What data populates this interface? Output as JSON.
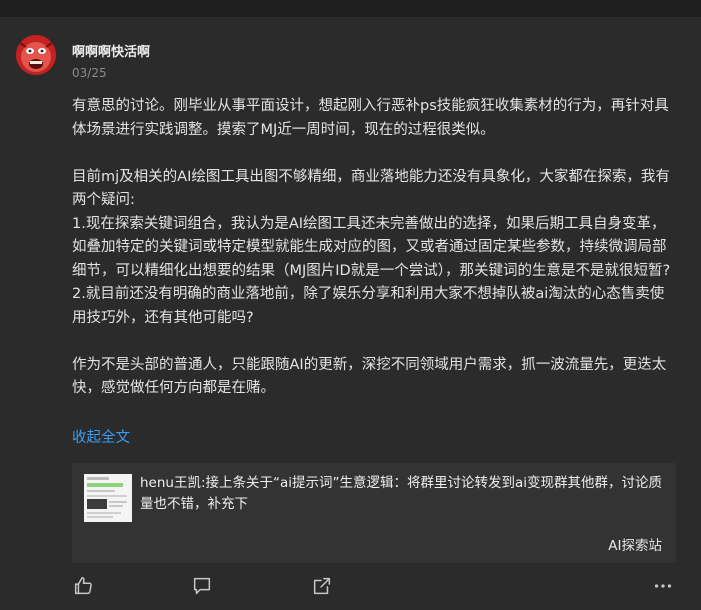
{
  "post": {
    "username": "啊啊啊快活啊",
    "date": "03/25",
    "paragraphs": [
      "有意思的讨论。刚毕业从事平面设计，想起刚入行恶补ps技能疯狂收集素材的行为，再针对具体场景进行实践调整。摸索了MJ近一周时间，现在的过程很类似。",
      "目前mj及相关的AI绘图工具出图不够精细，商业落地能力还没有具象化，大家都在探索，我有两个疑问:\n1.现在探索关键词组合，我认为是AI绘图工具还未完善做出的选择，如果后期工具自身变革，如叠加特定的关键词或特定模型就能生成对应的图，又或者通过固定某些参数，持续微调局部细节，可以精细化出想要的结果（MJ图片ID就是一个尝试），那关键词的生意是不是就很短暂?\n2.就目前还没有明确的商业落地前，除了娱乐分享和利用大家不想掉队被ai淘汰的心态售卖使用技巧外，还有其他可能吗?",
      "作为不是头部的普通人，只能跟随AI的更新，深挖不同领域用户需求，抓一波流量先，更迭太快，感觉做任何方向都是在赌。"
    ],
    "collapse_label": "收起全文"
  },
  "quote": {
    "text": "henu王凯:接上条关于“ai提示词”生意逻辑：将群里讨论转发到ai变现群其他群，讨论质量也不错，补充下",
    "source": "AI探索站"
  },
  "actions": {
    "icons": [
      "thumbs-up-icon",
      "comment-icon",
      "share-icon",
      "more-icon"
    ]
  },
  "colors": {
    "background": "#2b2b2b",
    "link": "#3d9bef",
    "quote_bg": "#333333"
  }
}
